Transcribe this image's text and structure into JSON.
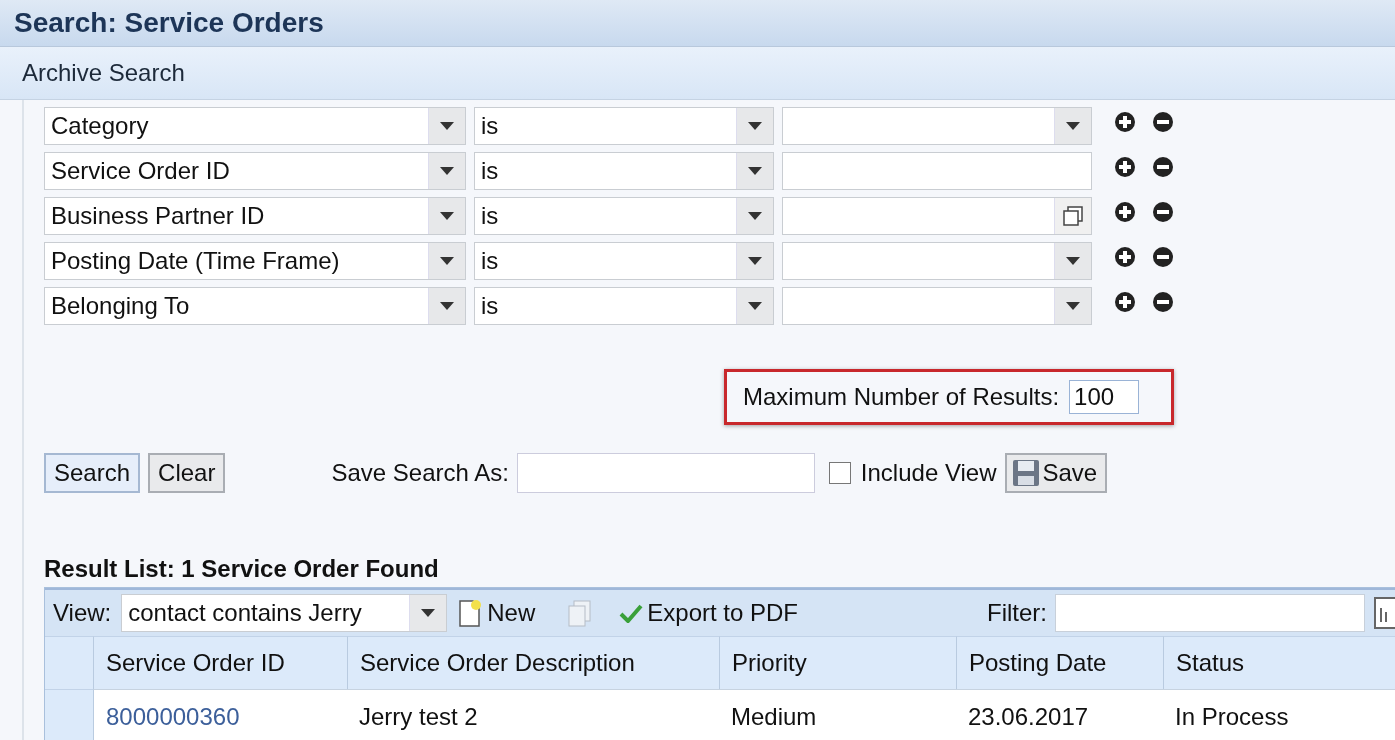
{
  "window": {
    "title": "Search: Service Orders"
  },
  "section": {
    "title": "Archive Search"
  },
  "criteria": [
    {
      "field": "Category",
      "operator": "is",
      "kind": "dropdown"
    },
    {
      "field": "Service Order ID",
      "operator": "is",
      "kind": "text"
    },
    {
      "field": "Business Partner ID",
      "operator": "is",
      "kind": "picker"
    },
    {
      "field": "Posting Date (Time Frame)",
      "operator": "is",
      "kind": "dropdown"
    },
    {
      "field": "Belonging To",
      "operator": "is",
      "kind": "dropdown"
    }
  ],
  "max_results": {
    "label": "Maximum Number of Results:",
    "value": "100",
    "highlighted": true
  },
  "buttons": [
    "Search",
    "Clear"
  ],
  "save_search": {
    "label": "Save Search As:",
    "include_view": {
      "label": "Include View",
      "checked": false
    },
    "save_button": "Save"
  },
  "result_list": {
    "title": "Result List: 1 Service Order Found",
    "view": {
      "label": "View:",
      "value": "contact contains Jerry"
    },
    "new_button": "New",
    "export_button": "Export to PDF",
    "filter_label": "Filter:",
    "columns": [
      "Service Order ID",
      "Service Order Description",
      "Priority",
      "Posting Date",
      "Status"
    ],
    "rows": [
      {
        "cells": [
          "8000000360",
          "Jerry test 2",
          "Medium",
          "23.06.2017",
          "In Process"
        ],
        "selected": false
      }
    ]
  }
}
